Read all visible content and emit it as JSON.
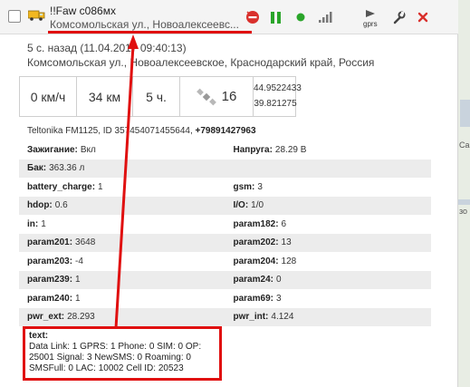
{
  "header": {
    "vehicle_name": "!!Faw с086мх",
    "vehicle_address": "Комсомольская ул., Новоалексеевс...",
    "gprs_label": "gprs"
  },
  "details": {
    "time_line": "5 с. назад (11.04.2017 09:40:13)",
    "address_line": "Комсомольская ул., Новоалексеевское, Краснодарский край, Россия",
    "speed": "0 км/ч",
    "distance": "34 км",
    "hours": "5 ч.",
    "satellites": "16",
    "lat": "44.9522433",
    "lon": "39.821275",
    "device_prefix": "Teltonika FM1125, ID 357454071455644, ",
    "device_phone": "+79891427963"
  },
  "params": [
    [
      {
        "k": "Зажигание:",
        "v": "Вкл"
      },
      {
        "k": "Напруга:",
        "v": "28.29 В"
      }
    ],
    [
      {
        "k": "Бак:",
        "v": "363.36 л"
      },
      {
        "k": "",
        "v": ""
      }
    ],
    [
      {
        "k": "battery_charge:",
        "v": "1"
      },
      {
        "k": "gsm:",
        "v": "3"
      }
    ],
    [
      {
        "k": "hdop:",
        "v": "0.6"
      },
      {
        "k": "I/O:",
        "v": "1/0"
      }
    ],
    [
      {
        "k": "in:",
        "v": "1"
      },
      {
        "k": "param182:",
        "v": "6"
      }
    ],
    [
      {
        "k": "param201:",
        "v": "3648"
      },
      {
        "k": "param202:",
        "v": "13"
      }
    ],
    [
      {
        "k": "param203:",
        "v": "-4"
      },
      {
        "k": "param204:",
        "v": "128"
      }
    ],
    [
      {
        "k": "param239:",
        "v": "1"
      },
      {
        "k": "param24:",
        "v": "0"
      }
    ],
    [
      {
        "k": "param240:",
        "v": "1"
      },
      {
        "k": "param69:",
        "v": "3"
      }
    ],
    [
      {
        "k": "pwr_ext:",
        "v": "28.293"
      },
      {
        "k": "pwr_int:",
        "v": "4.124"
      }
    ]
  ],
  "text_block": {
    "label": "text:",
    "line1": "Data Link: 1 GPRS: 1 Phone: 0 SIM: 0 OP:",
    "line2": "25001 Signal: 3 NewSMS: 0 Roaming: 0",
    "line3": "SMSFull: 0 LAC: 10002 Cell ID: 20523"
  },
  "map": {
    "label1": "Ca",
    "label2": "зо"
  },
  "colors": {
    "accent_red": "#e01010",
    "play_green": "#2aa52a",
    "dot_green": "#2aa52a",
    "stop_red": "#d9302c"
  },
  "icons": [
    "truck-icon",
    "stop-icon",
    "pause-icon",
    "dot-icon",
    "signal-icon",
    "gprs-icon",
    "wrench-icon",
    "close-icon",
    "satellite-icon"
  ]
}
